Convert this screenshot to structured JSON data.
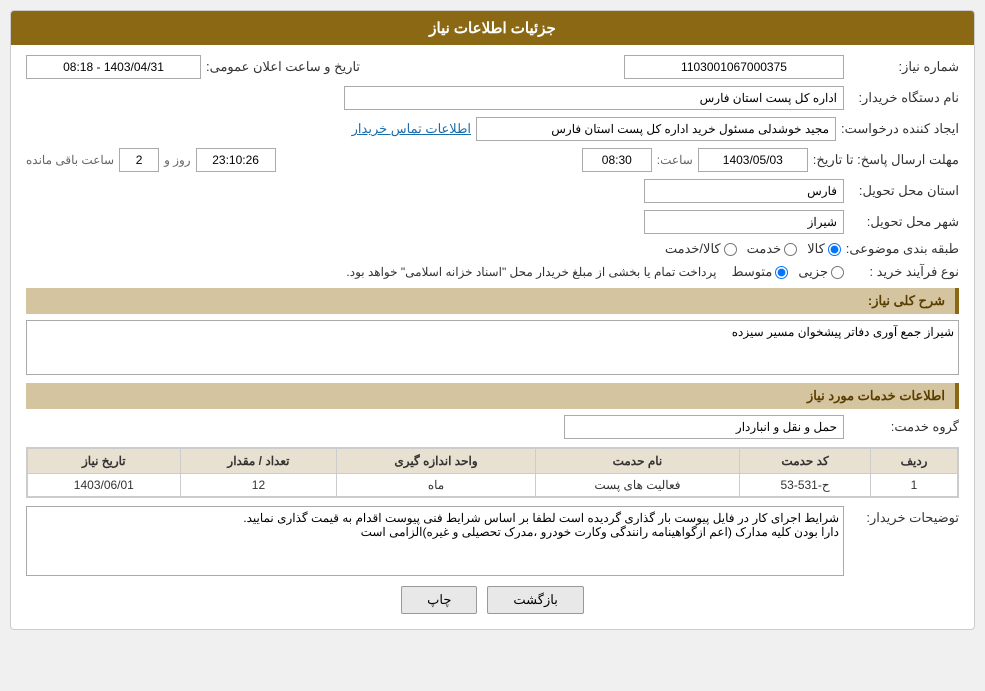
{
  "header": {
    "title": "جزئیات اطلاعات نیاز"
  },
  "fields": {
    "need_number_label": "شماره نیاز:",
    "need_number_value": "1103001067000375",
    "buyer_org_label": "نام دستگاه خریدار:",
    "buyer_org_value": "اداره کل پست استان فارس",
    "creator_label": "ایجاد کننده درخواست:",
    "creator_value": "مجید خوشدلی مسئول خرید اداره کل پست استان فارس",
    "contact_link": "اطلاعات تماس خریدار",
    "send_deadline_label": "مهلت ارسال پاسخ: تا تاریخ:",
    "send_date": "1403/05/03",
    "send_time_label": "ساعت:",
    "send_time": "08:30",
    "send_day_label": "روز و",
    "send_days": "2",
    "send_remaining_label": "ساعت باقی مانده",
    "send_remaining": "23:10:26",
    "announce_label": "تاریخ و ساعت اعلان عمومی:",
    "announce_value": "1403/04/31 - 08:18",
    "province_label": "استان محل تحویل:",
    "province_value": "فارس",
    "city_label": "شهر محل تحویل:",
    "city_value": "شیراز",
    "category_label": "طبقه بندی موضوعی:",
    "category_options": [
      "کالا",
      "خدمت",
      "کالا/خدمت"
    ],
    "category_selected": "کالا",
    "purchase_type_label": "نوع فرآیند خرید :",
    "purchase_options": [
      "جزیی",
      "متوسط"
    ],
    "purchase_note": "پرداخت تمام یا بخشی از مبلغ خریدار محل \"اسناد خزانه اسلامی\" خواهد بود.",
    "description_label": "شرح کلی نیاز:",
    "description_value": "شیراز جمع آوری دفاتر پیشخوان مسیر سیزده",
    "services_section": "اطلاعات خدمات مورد نیاز",
    "service_group_label": "گروه خدمت:",
    "service_group_value": "حمل و نقل و انباردار",
    "table": {
      "headers": [
        "ردیف",
        "کد حدمت",
        "نام حدمت",
        "واحد اندازه گیری",
        "تعداد / مقدار",
        "تاریخ نیاز"
      ],
      "rows": [
        {
          "row": "1",
          "code": "ح-531-53",
          "name": "فعالیت های پست",
          "unit": "ماه",
          "qty": "12",
          "date": "1403/06/01"
        }
      ]
    },
    "buyer_notes_label": "توضیحات خریدار:",
    "buyer_notes_value": "شرایط اجرای کار در فایل پیوست بار گذاری گردیده است لطفا بر اساس شرایط فنی پیوست اقدام به قیمت گذاری نمایید.\nدارا بودن کلیه مدارک (اعم ازگواهینامه رانندگی وکارت خودرو ،مدرک تحصیلی و غیره)الزامی است"
  },
  "buttons": {
    "print": "چاپ",
    "back": "بازگشت"
  }
}
